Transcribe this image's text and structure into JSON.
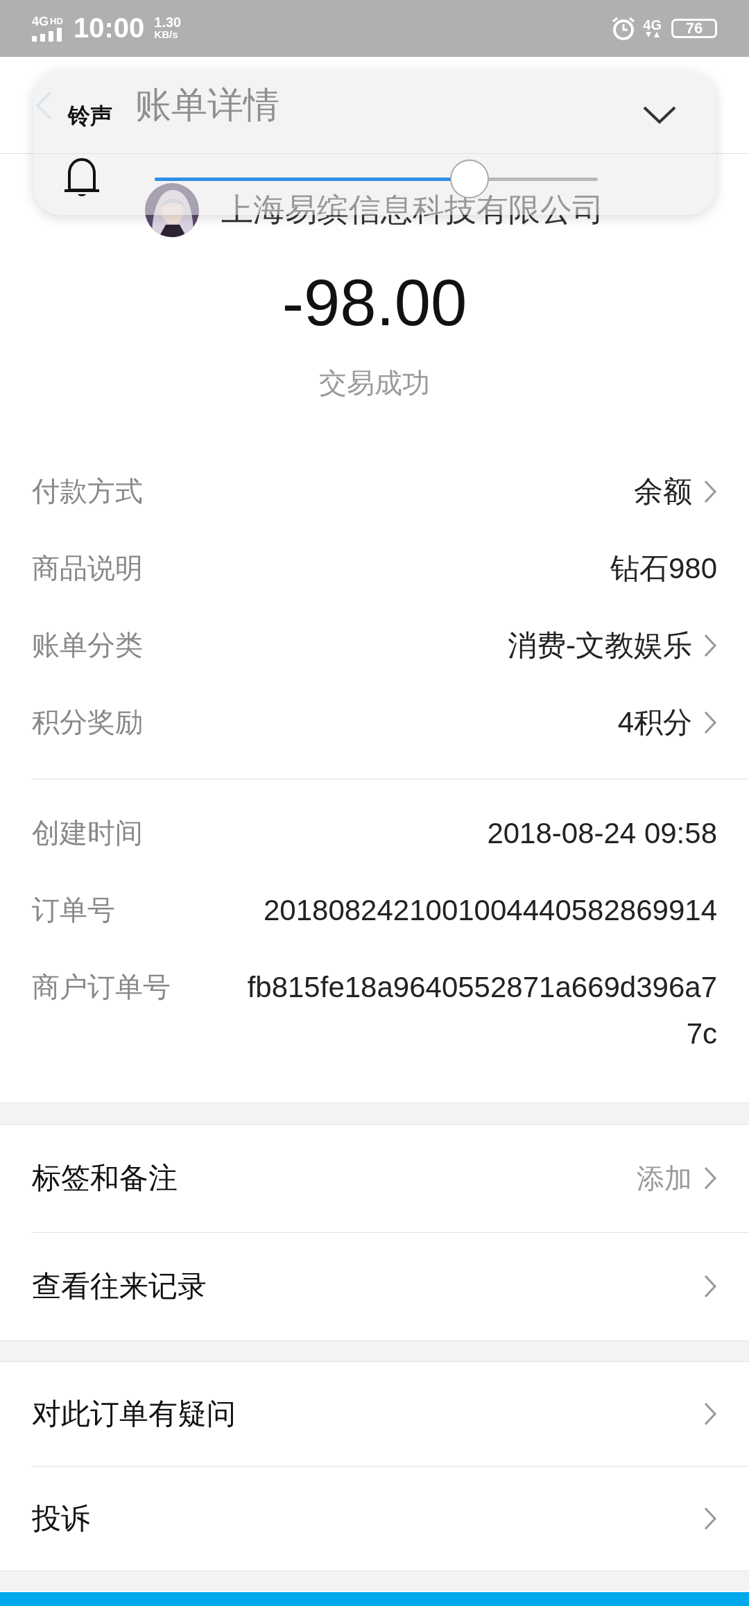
{
  "status_bar": {
    "network_top": "4G",
    "hd": "HD",
    "time": "10:00",
    "speed": "1.30",
    "speed_unit": "KB/s",
    "network_right": "4G",
    "battery": "76"
  },
  "header": {
    "title": "账单详情"
  },
  "volume_panel": {
    "label": "铃声",
    "level": 0.71
  },
  "merchant": {
    "name": "上海易缤信息科技有限公司"
  },
  "amount": "-98.00",
  "status": "交易成功",
  "details": [
    [
      {
        "label": "付款方式",
        "value": [
          "余额"
        ],
        "chevron": true
      },
      {
        "label": "商品说明",
        "value": [
          "钻石980"
        ],
        "chevron": false
      },
      {
        "label": "账单分类",
        "value": [
          "消费-文教娱乐"
        ],
        "chevron": true
      },
      {
        "label": "积分奖励",
        "value": [
          "4积分"
        ],
        "chevron": true
      }
    ],
    [
      {
        "label": "创建时间",
        "value": [
          "2018-08-24 09:58"
        ],
        "chevron": false
      },
      {
        "label": "订单号",
        "value": [
          "2018082421001004440582869914"
        ],
        "chevron": false
      },
      {
        "label": "商户订单号",
        "value": [
          "fb815fe18a9640552871a669d396a7",
          "7c"
        ],
        "chevron": false
      }
    ]
  ],
  "actions": [
    [
      {
        "label": "标签和备注",
        "hint": "添加",
        "chevron": true
      },
      {
        "label": "查看往来记录",
        "chevron": true
      }
    ],
    [
      {
        "label": "对此订单有疑问",
        "chevron": true
      },
      {
        "label": "投诉",
        "chevron": true
      }
    ]
  ]
}
